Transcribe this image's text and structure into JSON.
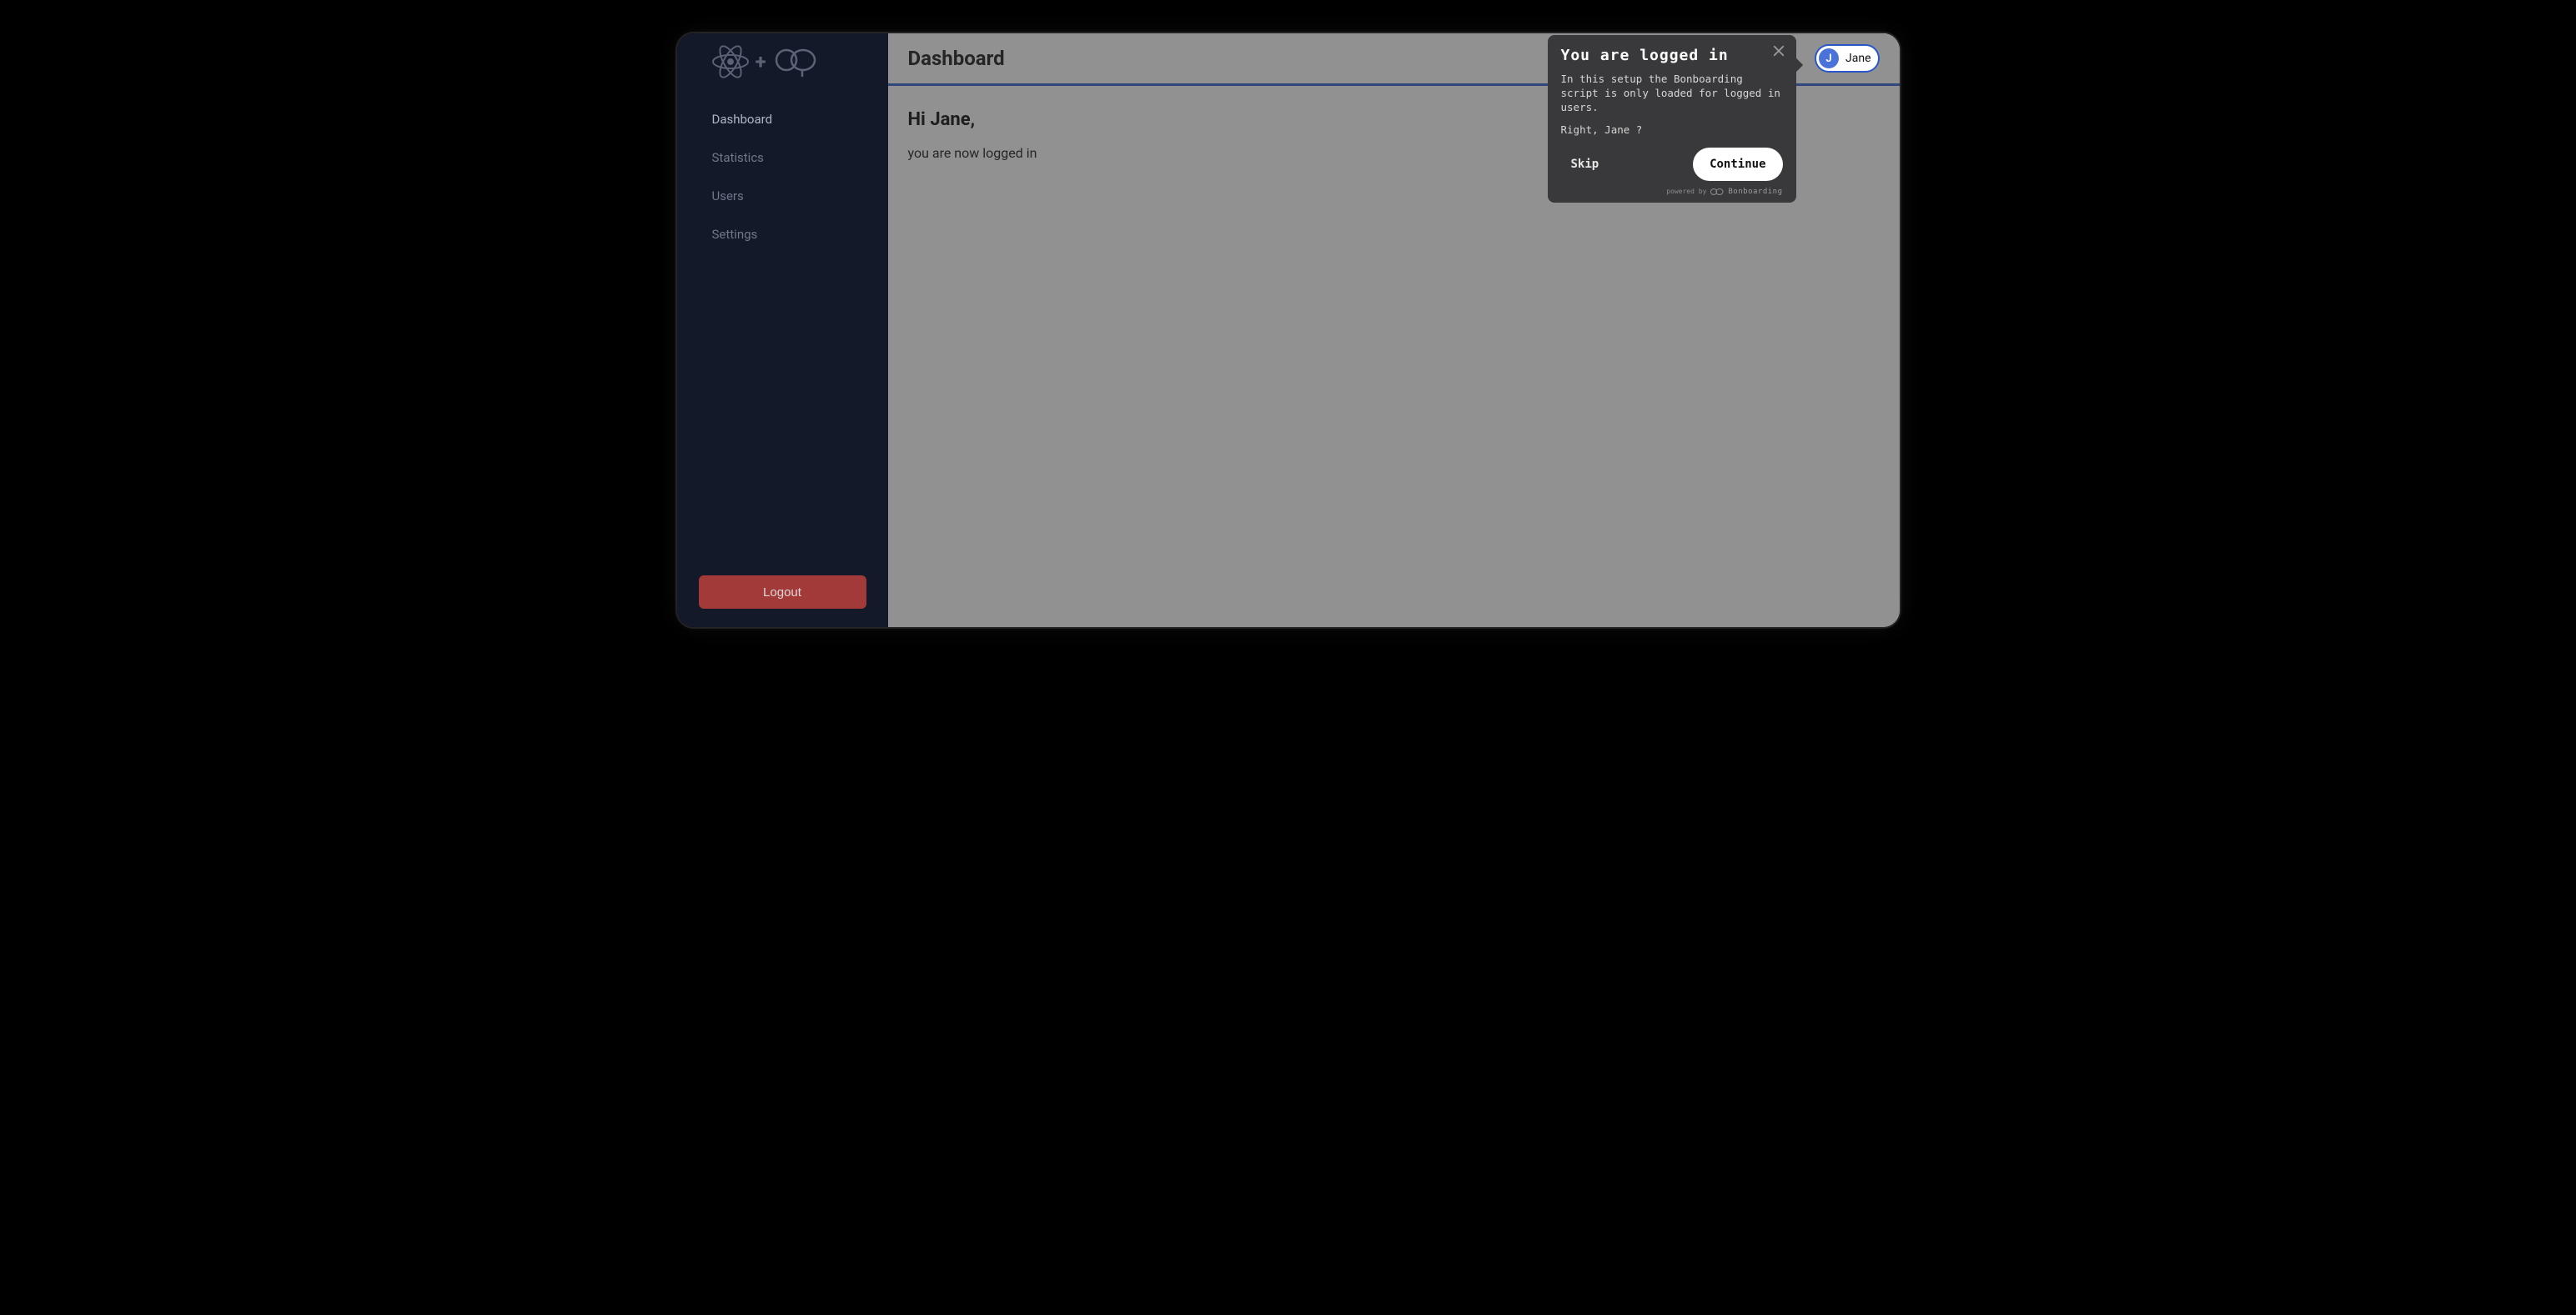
{
  "sidebar": {
    "items": [
      {
        "label": "Dashboard"
      },
      {
        "label": "Statistics"
      },
      {
        "label": "Users"
      },
      {
        "label": "Settings"
      }
    ],
    "logout_label": "Logout"
  },
  "topbar": {
    "title": "Dashboard",
    "user": {
      "initial": "J",
      "name": "Jane"
    }
  },
  "content": {
    "greeting": "Hi Jane,",
    "body": "you are now logged in"
  },
  "tooltip": {
    "title": "You are logged in",
    "body": "In this setup the Bonboarding script is only loaded for logged in users.",
    "body2": "Right, Jane ?",
    "skip_label": "Skip",
    "continue_label": "Continue",
    "powered_by": "powered by",
    "brand": "Bonboarding"
  }
}
